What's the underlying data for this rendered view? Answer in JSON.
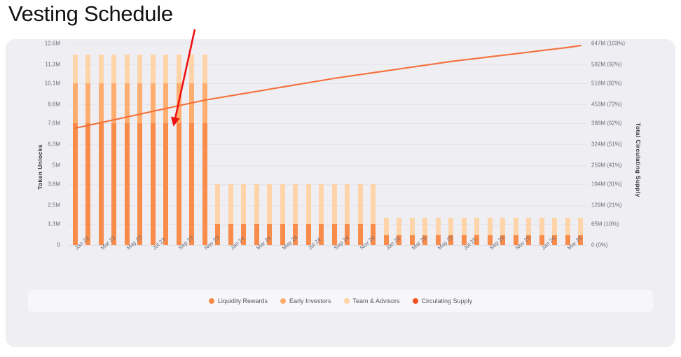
{
  "title": "Vesting Schedule",
  "legend": {
    "items": [
      {
        "label": "Liquidity Rewards",
        "color": "#f98c4a"
      },
      {
        "label": "Early Investors",
        "color": "#ffae70"
      },
      {
        "label": "Team & Advisors",
        "color": "#ffd4a8"
      },
      {
        "label": "Circulating Supply",
        "color": "#f4511e"
      }
    ]
  },
  "annotation": {
    "type": "arrow",
    "color": "#ee1111"
  },
  "colors": {
    "card_bg": "#eeeef3",
    "legend_bg": "#f7f7fa",
    "grid": "#e4e4ec",
    "line": "#f4703a"
  },
  "chart_data": {
    "type": "bar",
    "title": "Vesting Schedule",
    "xlabel": "",
    "ylabel": "Token Unlocks",
    "y2label": "Total Circulating Supply",
    "grid": true,
    "legend_position": "bottom",
    "ylim": [
      0,
      12600000
    ],
    "y_ticks": [
      "0",
      "1.3M",
      "2.5M",
      "3.8M",
      "5M",
      "6.3M",
      "7.6M",
      "8.8M",
      "10.1M",
      "11.3M",
      "12.6M"
    ],
    "y_tick_values": [
      0,
      1300000,
      2500000,
      3800000,
      5000000,
      6300000,
      7600000,
      8800000,
      10100000,
      11300000,
      12600000
    ],
    "y2_ticks": [
      "0 (0%)",
      "65M (10%)",
      "129M (21%)",
      "194M (31%)",
      "259M (41%)",
      "324M (51%)",
      "388M (62%)",
      "453M (72%)",
      "518M (82%)",
      "582M (92%)",
      "647M (103%)"
    ],
    "y2_tick_values": [
      0,
      65000000,
      129000000,
      194000000,
      259000000,
      324000000,
      388000000,
      453000000,
      518000000,
      582000000,
      647000000
    ],
    "y2lim": [
      0,
      647000000
    ],
    "categories": [
      "Jan 23",
      "Feb 23",
      "Mar 23",
      "Apr 23",
      "May 23",
      "Jun 23",
      "Jul 23",
      "Aug 23",
      "Sep 23",
      "Oct 23",
      "Nov 23",
      "Dec 23",
      "Jan 24",
      "Feb 24",
      "Mar 24",
      "Apr 24",
      "May 24",
      "Jun 24",
      "Jul 24",
      "Aug 24",
      "Sep 24",
      "Oct 24",
      "Nov 24",
      "Dec 24",
      "Jan 25",
      "Feb 25",
      "Mar 25",
      "Apr 25",
      "May 25",
      "Jun 25",
      "Jul 25",
      "Aug 25",
      "Sep 25",
      "Oct 25",
      "Nov 25",
      "Dec 25",
      "Jan 26",
      "Feb 26",
      "Mar 26",
      "Apr 26"
    ],
    "x_tick_labels": [
      "Jan 23",
      "Mar 23",
      "May 23",
      "Jul 23",
      "Sep 23",
      "Nov 23",
      "Jan 24",
      "Mar 24",
      "May 24",
      "Jul 24",
      "Sep 24",
      "Nov 24",
      "Jan 25",
      "Mar 25",
      "May 25",
      "Jul 25",
      "Sep 25",
      "Nov 25",
      "Jan 26",
      "Mar 26"
    ],
    "x_tick_indices": [
      0,
      2,
      4,
      6,
      8,
      10,
      12,
      14,
      16,
      18,
      20,
      22,
      24,
      26,
      28,
      30,
      32,
      34,
      36,
      38
    ],
    "stacked": true,
    "series": [
      {
        "name": "Liquidity Rewards",
        "color": "#f98c4a",
        "values": [
          7600000,
          7600000,
          7600000,
          7600000,
          7600000,
          7600000,
          7600000,
          7600000,
          7600000,
          7600000,
          7600000,
          1300000,
          1300000,
          1300000,
          1300000,
          1300000,
          1300000,
          1300000,
          1300000,
          1300000,
          1300000,
          1300000,
          1300000,
          1300000,
          600000,
          600000,
          600000,
          600000,
          600000,
          600000,
          600000,
          600000,
          600000,
          600000,
          600000,
          600000,
          600000,
          600000,
          600000,
          600000
        ]
      },
      {
        "name": "Early Investors",
        "color": "#ffae70",
        "values": [
          2500000,
          2500000,
          2500000,
          2500000,
          2500000,
          2500000,
          2500000,
          2500000,
          2500000,
          2500000,
          2500000,
          0,
          0,
          0,
          0,
          0,
          0,
          0,
          0,
          0,
          0,
          0,
          0,
          0,
          0,
          0,
          0,
          0,
          0,
          0,
          0,
          0,
          0,
          0,
          0,
          0,
          0,
          0,
          0,
          0
        ]
      },
      {
        "name": "Team & Advisors",
        "color": "#ffd4a8",
        "values": [
          1800000,
          1800000,
          1800000,
          1800000,
          1800000,
          1800000,
          1800000,
          1800000,
          1800000,
          1800000,
          1800000,
          2500000,
          2500000,
          2500000,
          2500000,
          2500000,
          2500000,
          2500000,
          2500000,
          2500000,
          2500000,
          2500000,
          2500000,
          2500000,
          1100000,
          1100000,
          1100000,
          1100000,
          1100000,
          1100000,
          1100000,
          1100000,
          1100000,
          1100000,
          1100000,
          1100000,
          1100000,
          1100000,
          1100000,
          1100000
        ]
      }
    ],
    "line_series": {
      "name": "Circulating Supply",
      "color": "#f4703a",
      "axis": "right",
      "values": [
        375000000,
        384000000,
        393000000,
        402000000,
        411000000,
        420000000,
        429000000,
        438000000,
        447000000,
        456000000,
        465000000,
        472000000,
        479000000,
        486000000,
        493000000,
        500000000,
        507000000,
        514000000,
        521000000,
        528000000,
        535000000,
        541000000,
        547000000,
        553000000,
        559000000,
        565000000,
        571000000,
        577000000,
        583000000,
        589000000,
        594000000,
        599000000,
        604000000,
        609000000,
        614000000,
        619000000,
        624000000,
        629000000,
        634000000,
        640000000
      ]
    }
  }
}
